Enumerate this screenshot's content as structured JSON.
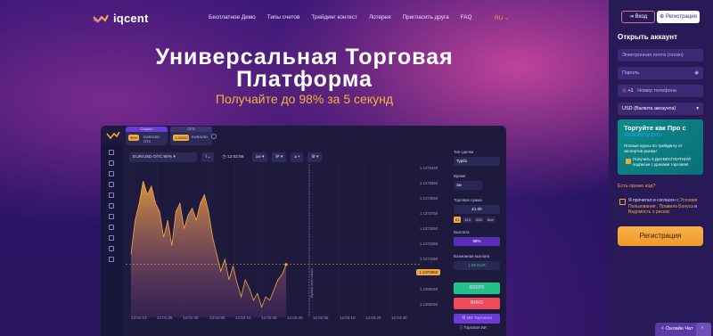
{
  "brand": {
    "name": "iqcent"
  },
  "nav": {
    "links": [
      "Бесплатное Демо",
      "Типы счетов",
      "Трейдинг контест",
      "Лотерея",
      "Пригласить друга",
      "FAQ"
    ],
    "language": "RU"
  },
  "hero": {
    "title_line1": "Универсальная Торговая",
    "title_line2": "Платформа",
    "subtitle": "Получайте до 98% за 5 секунд"
  },
  "platform": {
    "tabs": [
      {
        "header": "Опцион",
        "percent": "90%",
        "asset": "EUR/USD OTC",
        "sub": "00:00"
      },
      {
        "header": "CFD",
        "percent": "1.20000",
        "asset": "EUR/USD",
        "sub": "00:00"
      }
    ],
    "toolbar": {
      "asset": "EUR/USD OTC 90%",
      "time": "12:02:58",
      "timeframe": "1м"
    },
    "price_labels": [
      "1.1376450",
      "1.1375550",
      "1.1374650",
      "1.1373750",
      "1.1372850",
      "1.1371950",
      "1.1371050",
      "1.1370150",
      "1.1369250",
      "1.1368350"
    ],
    "current_price": "1.1370950",
    "time_labels": [
      "12:01:10",
      "12:01:25",
      "12:01:40",
      "12:01:55",
      "12:02:10",
      "12:02:25",
      "12:02:40",
      "12:02:55",
      "12:03:10",
      "12:03:25",
      "12:03:40"
    ],
    "expiry_label": "Время окончания",
    "trade_type_label": "Тип сделки",
    "trade_type_value": "Турбо",
    "time_label": "Время",
    "time_value": "1м",
    "amount_label": "Торговая сумма",
    "amount_value": "£1.00",
    "quick_amounts": [
      "£1",
      "£10",
      "£50",
      "Все"
    ],
    "payout_label": "Выплата",
    "payout_value": "98%",
    "possible_payout_label": "Возможная выплата",
    "possible_payout_value": "1.98 EUR",
    "up_label": "ВВЕРХ",
    "down_label": "ВНИЗ",
    "ai_label": "ИИ Торговля",
    "ai_footer": "Торговля ИИ",
    "chart_data": {
      "type": "area",
      "values": [
        1.13715,
        1.13735,
        1.13745,
        1.13758,
        1.1375,
        1.13755,
        1.13745,
        1.1374,
        1.13725,
        1.13735,
        1.1372,
        1.1374,
        1.13745,
        1.1373,
        1.13738,
        1.13742,
        1.13735,
        1.13745,
        1.1375,
        1.1374,
        1.13725,
        1.13715,
        1.13705,
        1.13712,
        1.137,
        1.13708,
        1.13698,
        1.1369,
        1.137,
        1.13695,
        1.13688,
        1.13692,
        1.13684,
        1.1369,
        1.13688,
        1.13694,
        1.137,
        1.13703,
        1.13709
      ]
    }
  },
  "sidebar": {
    "login": "Вход",
    "register_top": "Регистрация",
    "open_account": "Открыть аккаунт",
    "email_placeholder": "Электронная почта (логин)",
    "password_placeholder": "Пароль",
    "phone_code": "+1",
    "phone_placeholder": "Номер телефона",
    "currency": "USD (Валюта аккаунта)",
    "promo": {
      "title": "Торгуйте как Про с",
      "sub": "Academy.pro",
      "text": "Полные курсы по трейдингу от экспертов рынка!",
      "text2": "Получить 3 Дня БЕСПЛАТНОЙ подписки с уроками торговли!"
    },
    "promo_question": "Есть промо код?",
    "agree_prefix": "Я прочитал и согласен с",
    "agree_links": "Условия Пользования , Правила Бонуса",
    "agree_and": "и",
    "agree_links2": "Ведомость о рисках",
    "register": "Регистрация",
    "chat": "Онлайн Чат"
  }
}
